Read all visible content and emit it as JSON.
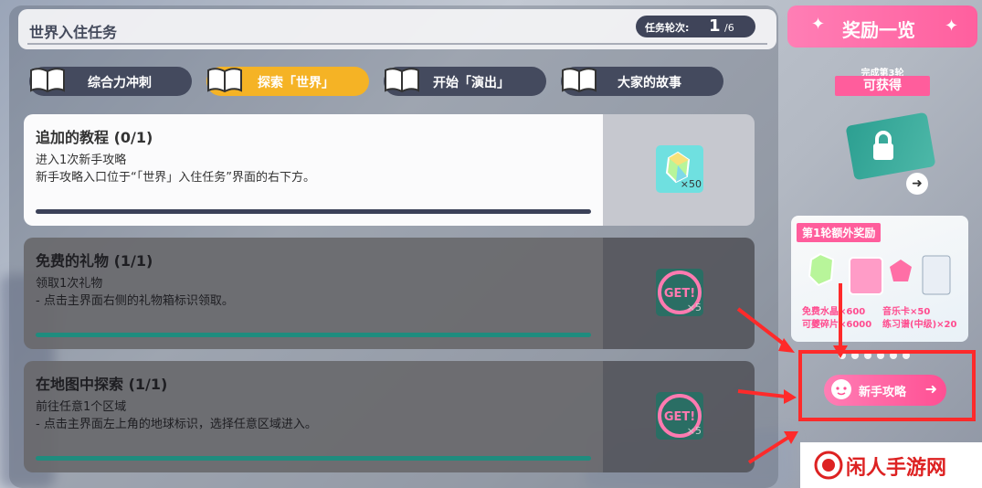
{
  "header": {
    "title": "世界入住任务",
    "round_label": "任务轮次:",
    "round_current": "1",
    "round_total": "/6"
  },
  "tabs": [
    {
      "label": "综合力冲刺",
      "active": false
    },
    {
      "label": "探索「世界」",
      "active": true
    },
    {
      "label": "开始「演出」",
      "active": false
    },
    {
      "label": "大家的故事",
      "active": false
    }
  ],
  "tasks": [
    {
      "title": "追加的教程 (0/1)",
      "line1": "进入1次新手攻略",
      "line2": "新手攻略入口位于“「世界」入住任务”界面的右下方。",
      "reward_qty": "×50",
      "state": "open"
    },
    {
      "title": "免费的礼物 (1/1)",
      "line1": "领取1次礼物",
      "line2": "- 点击主界面右侧的礼物箱标识领取。",
      "reward_qty": "×5",
      "state": "done"
    },
    {
      "title": "在地图中探索 (1/1)",
      "line1": "前往任意1个区域",
      "line2": "- 点击主界面左上角的地球标识，选择任意区域进入。",
      "reward_qty": "×5",
      "state": "done"
    }
  ],
  "done_badge": "GET!",
  "rewards": {
    "header": "奖励一览",
    "ribbon_top": "完成第3轮",
    "ribbon_main": "可获得",
    "bonus_title": "第1轮额外奖励",
    "bonus_items": [
      "免费水晶×600",
      "可夔碎片×6000",
      "音乐卡×50",
      "练习谱(中级)×20"
    ],
    "guide_label": "新手攻略"
  },
  "watermark": "闲人手游网",
  "colors": {
    "accent_pink": "#ff5d9c",
    "tab_active": "#f5b325",
    "tab_inactive": "#444a5e",
    "progress_done": "#1f8c7e"
  }
}
